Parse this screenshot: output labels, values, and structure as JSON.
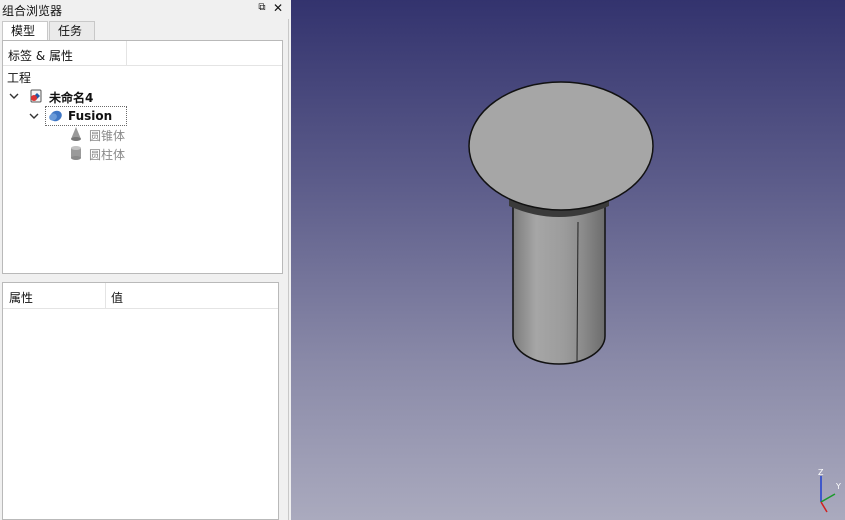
{
  "combo_view": {
    "title": "组合浏览器",
    "float_glyph": "⧉",
    "close_glyph": "✕",
    "tabs": [
      {
        "label": "模型",
        "active": true
      },
      {
        "label": "任务",
        "active": false
      }
    ]
  },
  "tree": {
    "header": "标签 & 属性",
    "project_label": "工程",
    "document": {
      "label": "未命名4",
      "icon": "document-icon",
      "expanded": true
    },
    "fusion": {
      "label": "Fusion",
      "icon": "fusion-icon",
      "expanded": true,
      "selected": true
    },
    "children": [
      {
        "label": "圆锥体",
        "icon": "cone-icon"
      },
      {
        "label": "圆柱体",
        "icon": "cylinder-icon"
      }
    ]
  },
  "properties": {
    "col_property": "属性",
    "col_value": "值"
  },
  "view3d": {
    "background_top": "#33336e",
    "background_bottom": "#aaaabe",
    "model": "fusion of cone and cylinder (cap and shaft)",
    "axis_labels": {
      "z": "Z",
      "y": "Y",
      "x": "X"
    }
  }
}
